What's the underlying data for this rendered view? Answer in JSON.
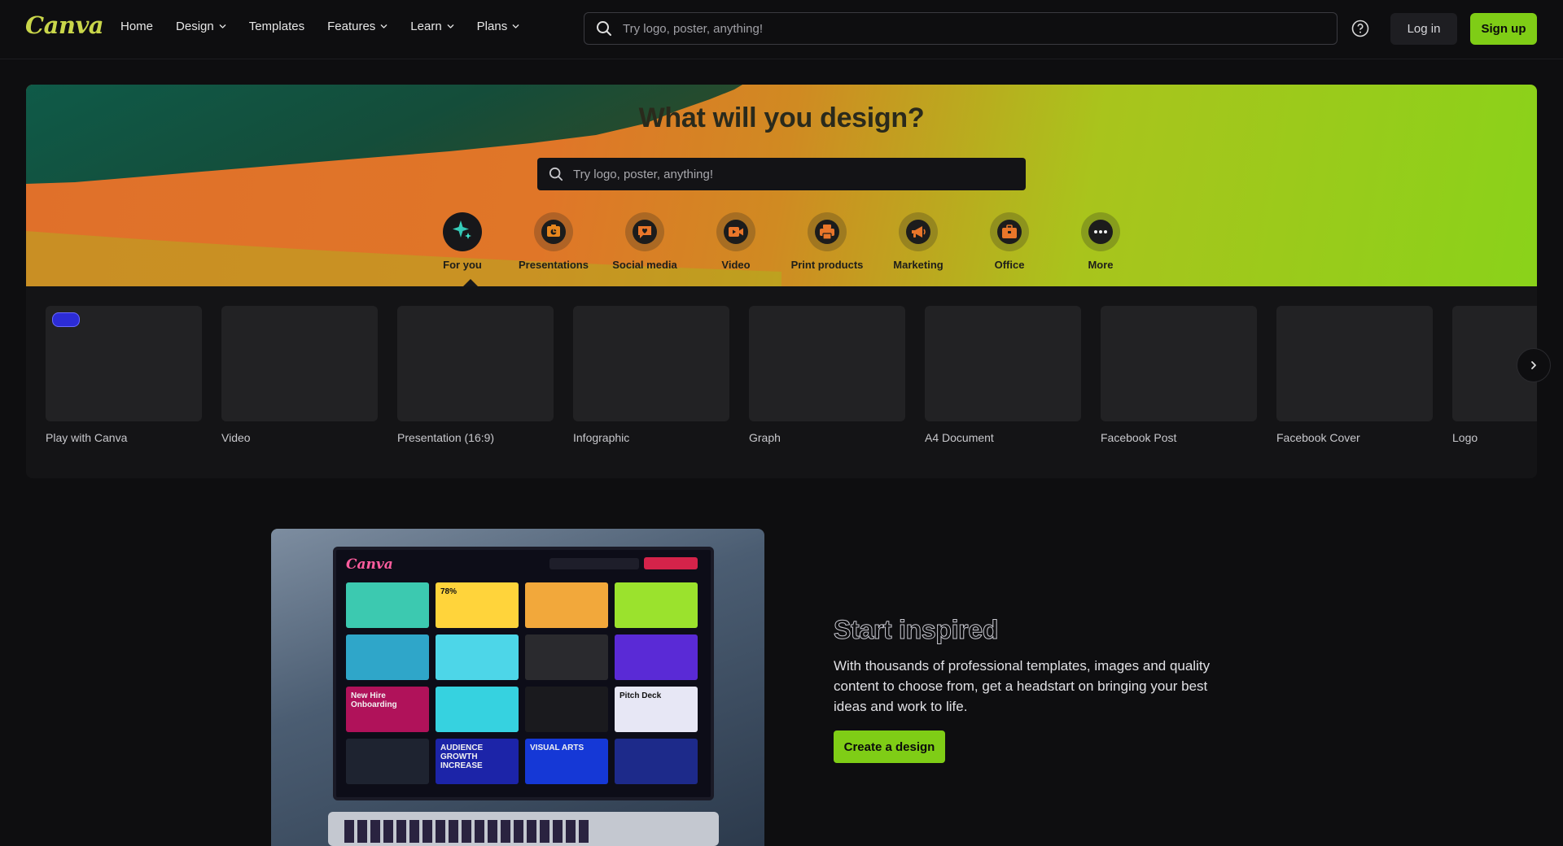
{
  "header": {
    "logo": "Canva",
    "nav": [
      {
        "label": "Home",
        "has_menu": false
      },
      {
        "label": "Design",
        "has_menu": true
      },
      {
        "label": "Templates",
        "has_menu": false
      },
      {
        "label": "Features",
        "has_menu": true
      },
      {
        "label": "Learn",
        "has_menu": true
      },
      {
        "label": "Plans",
        "has_menu": true
      }
    ],
    "search_placeholder": "Try logo, poster, anything!",
    "help_icon": "help-circle-icon",
    "login_label": "Log in",
    "signup_label": "Sign up"
  },
  "hero": {
    "title": "What will you design?",
    "search_placeholder": "Try logo, poster, anything!",
    "categories": [
      {
        "label": "For you",
        "icon": "sparkle-icon",
        "active": true
      },
      {
        "label": "Presentations",
        "icon": "presentation-icon",
        "active": false
      },
      {
        "label": "Social media",
        "icon": "heart-chat-icon",
        "active": false
      },
      {
        "label": "Video",
        "icon": "video-icon",
        "active": false
      },
      {
        "label": "Print products",
        "icon": "printer-icon",
        "active": false
      },
      {
        "label": "Marketing",
        "icon": "megaphone-icon",
        "active": false
      },
      {
        "label": "Office",
        "icon": "briefcase-icon",
        "active": false
      },
      {
        "label": "More",
        "icon": "more-dots-icon",
        "active": false
      }
    ]
  },
  "design_types": [
    {
      "label": "Play with Canva"
    },
    {
      "label": "Video"
    },
    {
      "label": "Presentation (16:9)"
    },
    {
      "label": "Infographic"
    },
    {
      "label": "Graph"
    },
    {
      "label": "A4 Document"
    },
    {
      "label": "Facebook Post"
    },
    {
      "label": "Facebook Cover"
    },
    {
      "label": "Logo"
    }
  ],
  "inspired": {
    "title": "Start inspired",
    "body": "With thousands of professional templates, images and quality content to choose from, get a headstart on bringing your best ideas and work to life.",
    "cta_label": "Create a design",
    "screen_logo": "Canva",
    "tiles": [
      {
        "text": "",
        "color": "#3cc9b0"
      },
      {
        "text": "78%",
        "color": "#ffd43b"
      },
      {
        "text": "",
        "color": "#f2a83b"
      },
      {
        "text": "",
        "color": "#9be22d"
      },
      {
        "text": "",
        "color": "#2fa6c9"
      },
      {
        "text": "",
        "color": "#4dd6e8"
      },
      {
        "text": "",
        "color": "#2a2a2e"
      },
      {
        "text": "",
        "color": "#5a2ad6"
      },
      {
        "text": "New Hire Onboarding",
        "color": "#b0125a"
      },
      {
        "text": "",
        "color": "#36d2e0"
      },
      {
        "text": "",
        "color": "#1a1a1e"
      },
      {
        "text": "Pitch Deck",
        "color": "#e7e7f5"
      },
      {
        "text": "",
        "color": "#1e2330"
      },
      {
        "text": "AUDIENCE GROWTH INCREASE",
        "color": "#1c24a8"
      },
      {
        "text": "VISUAL ARTS",
        "color": "#1538d6"
      },
      {
        "text": "",
        "color": "#1d2a8a"
      }
    ]
  },
  "colors": {
    "accent": "#7fcd16",
    "background": "#0e0e10"
  }
}
